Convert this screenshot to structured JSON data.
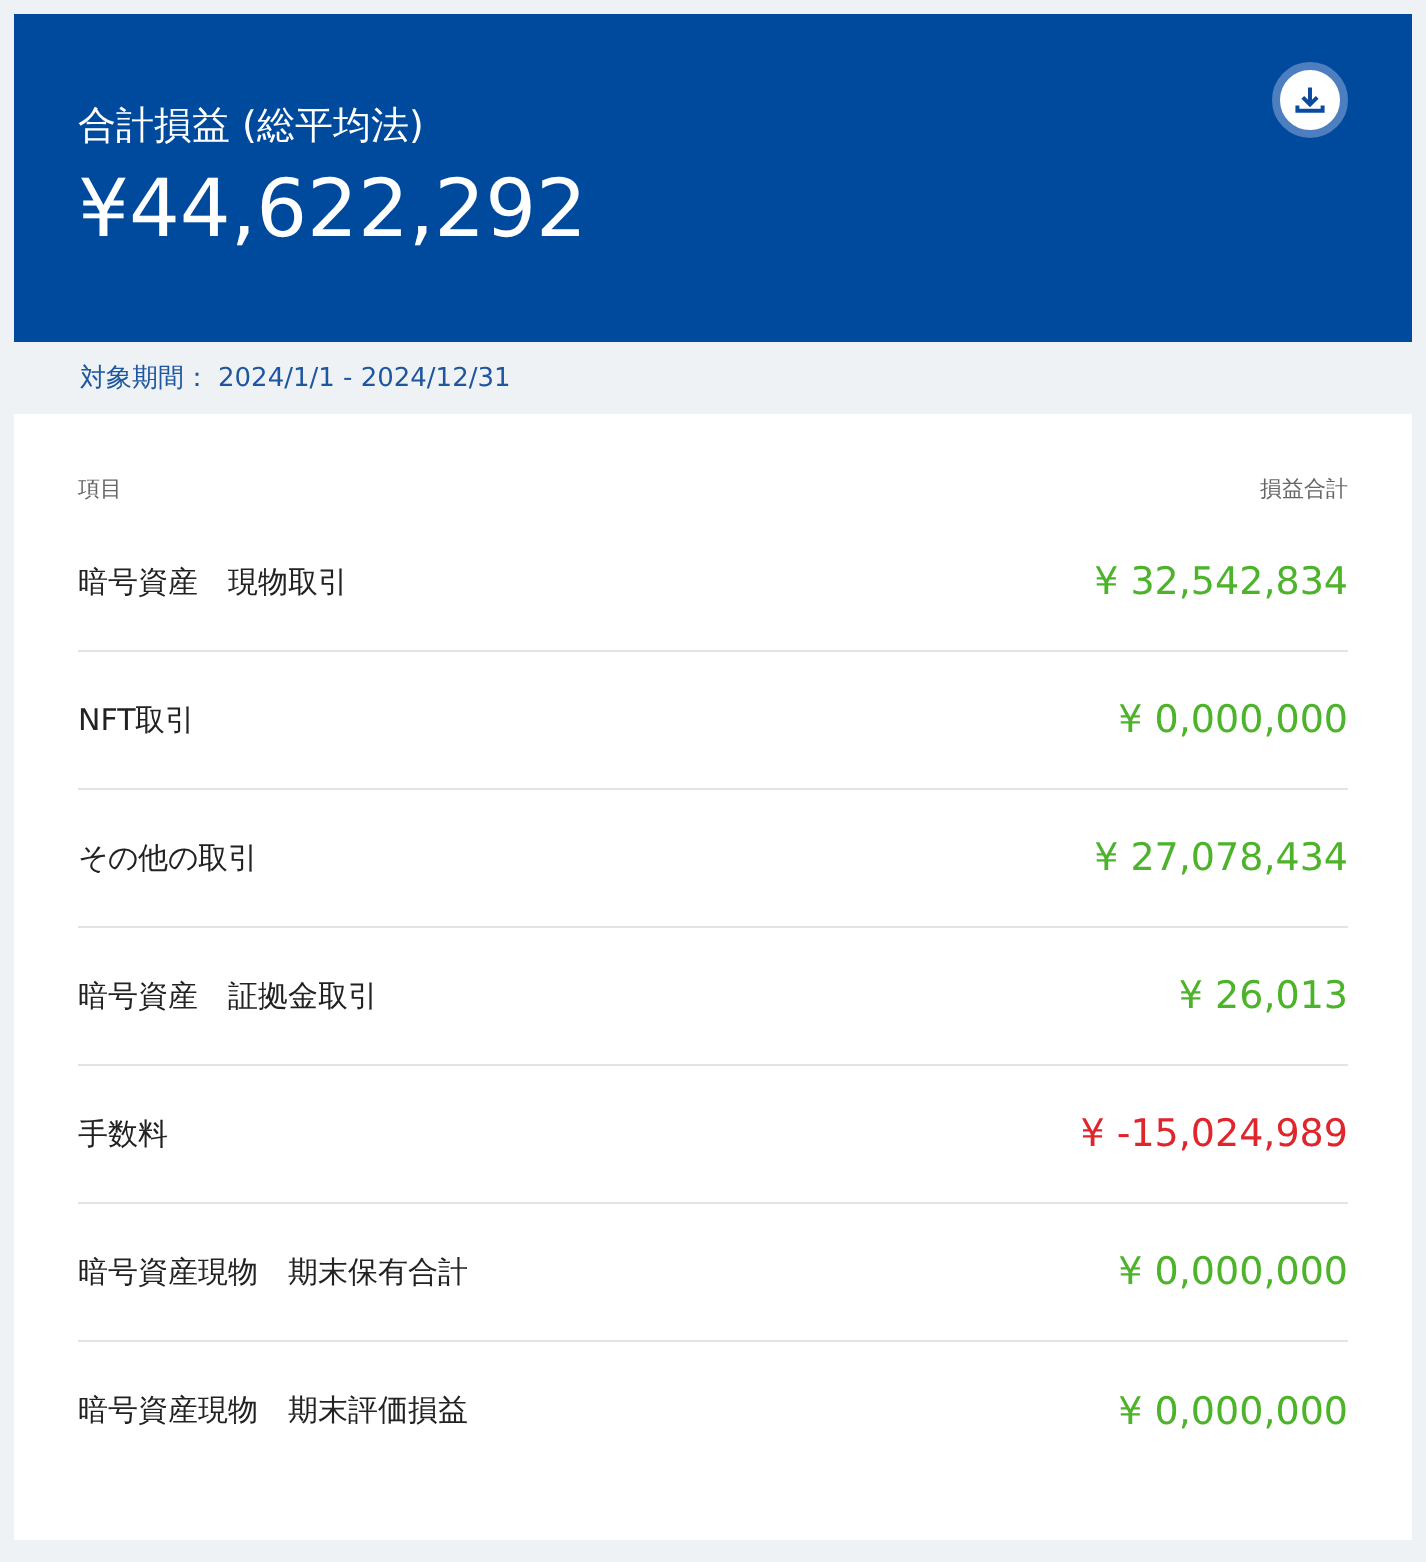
{
  "summary": {
    "title": "合計損益 (総平均法)",
    "total": "¥44,622,292"
  },
  "period": {
    "label": "対象期間：",
    "range": "2024/1/1 - 2024/12/31"
  },
  "table": {
    "columns": [
      "項目",
      "損益合計"
    ],
    "rows": [
      {
        "item": "暗号資産　現物取引",
        "amount": "¥ 32,542,834",
        "color": "#4cb32a"
      },
      {
        "item": "NFT取引",
        "amount": "¥ 0,000,000",
        "color": "#4cb32a"
      },
      {
        "item": "その他の取引",
        "amount": "¥ 27,078,434",
        "color": "#4cb32a"
      },
      {
        "item": "暗号資産　証拠金取引",
        "amount": "¥ 26,013",
        "color": "#4cb32a"
      },
      {
        "item": "手数料",
        "amount": "¥ -15,024,989",
        "color": "#e0262d"
      },
      {
        "item": "暗号資産現物　期末保有合計",
        "amount": "¥ 0,000,000",
        "color": "#4cb32a"
      },
      {
        "item": "暗号資産現物　期末評価損益",
        "amount": "¥ 0,000,000",
        "color": "#4cb32a"
      }
    ]
  }
}
